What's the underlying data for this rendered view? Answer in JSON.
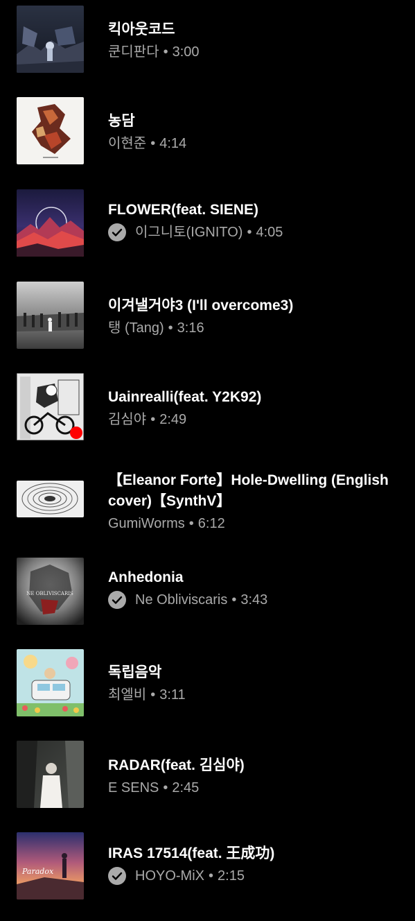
{
  "tracks": [
    {
      "title": "킥아웃코드",
      "artist": "쿤디판다",
      "duration": "3:00",
      "verified": false
    },
    {
      "title": "농담",
      "artist": "이현준",
      "duration": "4:14",
      "verified": false
    },
    {
      "title": "FLOWER(feat. SIENE)",
      "artist": "이그니토(IGNITO)",
      "duration": "4:05",
      "verified": true
    },
    {
      "title": "이겨낼거야3 (I'll overcome3)",
      "artist": "탱 (Tang)",
      "duration": "3:16",
      "verified": false
    },
    {
      "title": "Uainrealli(feat. Y2K92)",
      "artist": "김심야",
      "duration": "2:49",
      "verified": false
    },
    {
      "title": "【Eleanor Forte】Hole-Dwelling (English cover)【SynthV】",
      "artist": "GumiWorms",
      "duration": "6:12",
      "verified": false
    },
    {
      "title": "Anhedonia",
      "artist": "Ne Obliviscaris",
      "duration": "3:43",
      "verified": true
    },
    {
      "title": "독립음악",
      "artist": "최엘비",
      "duration": "3:11",
      "verified": false
    },
    {
      "title": "RADAR(feat. 김심야)",
      "artist": "E SENS",
      "duration": "2:45",
      "verified": false
    },
    {
      "title": "IRAS 17514(feat. 王成功)",
      "artist": "HOYO-MiX",
      "duration": "2:15",
      "verified": true
    }
  ],
  "separator": "•",
  "thumb_art_text": {
    "anhedonia": "NE OBLIVISCARIS",
    "iras": "Paradox"
  },
  "colors": {
    "background": "#000000",
    "title": "#ffffff",
    "subtitle": "#aaaaaa",
    "verified_badge": "#aaaaaa",
    "recording_dot": "#ff0000"
  }
}
